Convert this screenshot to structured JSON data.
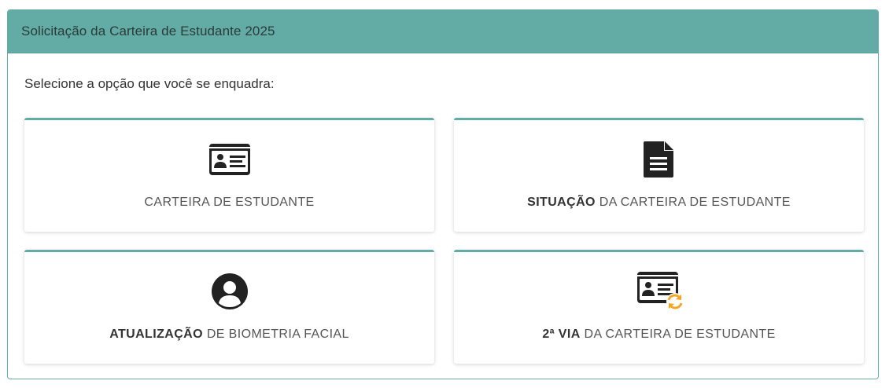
{
  "panel": {
    "title": "Solicitação da Carteira de Estudante 2025",
    "instruction": "Selecione a opção que você se enquadra:"
  },
  "options": [
    {
      "bold": "",
      "rest": "CARTEIRA DE ESTUDANTE",
      "icon": "id-card-icon"
    },
    {
      "bold": "SITUAÇÃO",
      "rest": " DA CARTEIRA DE ESTUDANTE",
      "icon": "document-icon"
    },
    {
      "bold": "ATUALIZAÇÃO",
      "rest": " DE BIOMETRIA FACIAL",
      "icon": "user-circle-icon"
    },
    {
      "bold": "2ª VIA",
      "rest": " DA CARTEIRA DE ESTUDANTE",
      "icon": "id-card-refresh-icon"
    }
  ],
  "colors": {
    "accent": "#63aca5",
    "refresh": "#f5a623",
    "icon": "#222222"
  }
}
